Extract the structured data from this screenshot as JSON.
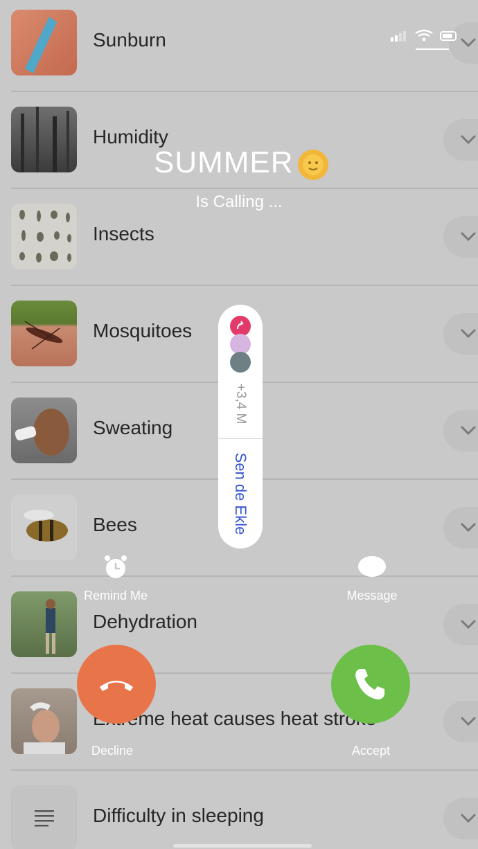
{
  "list": {
    "items": [
      {
        "label": "Sunburn",
        "thumb": "sunburn-photo"
      },
      {
        "label": "Humidity",
        "thumb": "forest-photo"
      },
      {
        "label": "Insects",
        "thumb": "insects-chart"
      },
      {
        "label": "Mosquitoes",
        "thumb": "mosquito-photo"
      },
      {
        "label": "Sweating",
        "thumb": "drinking-man-photo"
      },
      {
        "label": "Bees",
        "thumb": "bee-photo"
      },
      {
        "label": "Dehydration",
        "thumb": "hiker-photo"
      },
      {
        "label": "Extreme heat causes heat stroke",
        "thumb": "woman-water-photo"
      },
      {
        "label": "Difficulty in sleeping",
        "thumb": "text-lines-icon"
      }
    ]
  },
  "call": {
    "caller": "SUMMER",
    "caller_emoji": "sun-face-icon",
    "status": "Is Calling ...",
    "remind_label": "Remind Me",
    "message_label": "Message",
    "decline_label": "Decline",
    "accept_label": "Accept"
  },
  "pill": {
    "count": "+3,4 M",
    "join_label": "Sen de Ekle"
  },
  "colors": {
    "background": "#c9c9c9",
    "decline": "#e8744a",
    "accept": "#6cc04a",
    "join_link": "#3454d1"
  }
}
